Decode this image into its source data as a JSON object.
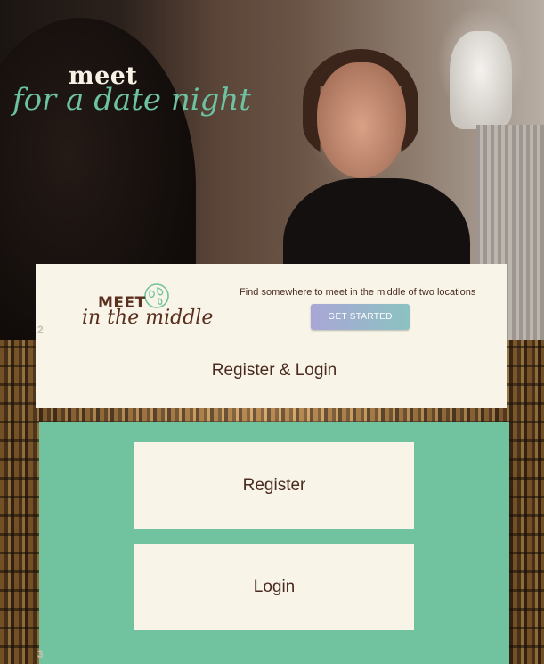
{
  "hero": {
    "title_line1": "meet",
    "title_line2": "for a date night"
  },
  "header": {
    "logo_line1": "MEET",
    "logo_line2": "in the middle",
    "tagline": "Find somewhere to meet in the middle of two locations",
    "cta_label": "GET STARTED"
  },
  "section": {
    "title": "Register & Login",
    "number_top": "2",
    "number_bottom": "3"
  },
  "auth": {
    "register_label": "Register",
    "login_label": "Login"
  },
  "colors": {
    "cream": "#f8f4e8",
    "green": "#71c29e",
    "brown_text": "#4b2a1f",
    "hero_script": "#6dc2a2"
  }
}
